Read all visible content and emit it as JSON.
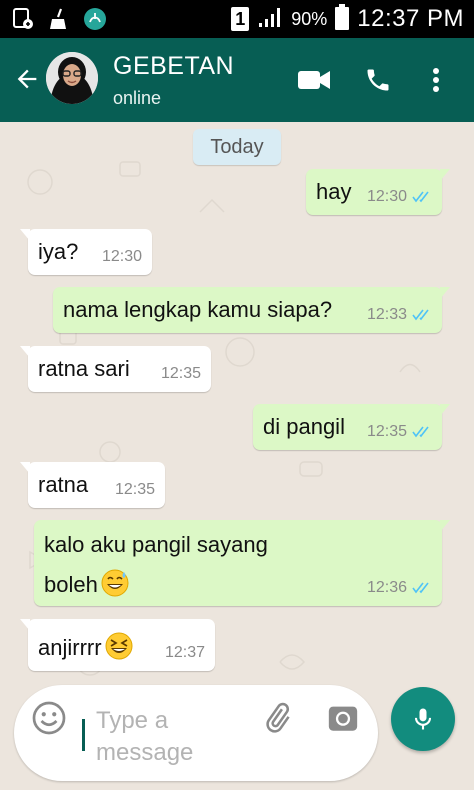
{
  "status_bar": {
    "sim_slot": "1",
    "battery_percent": "90%",
    "time": "12:37 PM",
    "icons": [
      "screenshot-icon",
      "cleaner-icon",
      "islamic-app-icon",
      "sim-icon",
      "signal-icon",
      "battery-icon"
    ]
  },
  "header": {
    "contact_name": "GEBETAN",
    "contact_status": "online",
    "icons": [
      "back-arrow-icon",
      "video-call-icon",
      "phone-call-icon",
      "more-vert-icon"
    ],
    "colors": {
      "bar": "#075e54"
    }
  },
  "chat": {
    "date_label": "Today",
    "messages": [
      {
        "direction": "out",
        "text": "hay",
        "time": "12:30",
        "read": true
      },
      {
        "direction": "in",
        "text": "iya?",
        "time": "12:30"
      },
      {
        "direction": "out",
        "text": "nama lengkap kamu siapa?",
        "time": "12:33",
        "read": true
      },
      {
        "direction": "in",
        "text": "ratna sari",
        "time": "12:35"
      },
      {
        "direction": "out",
        "text": "di pangil",
        "time": "12:35",
        "read": true
      },
      {
        "direction": "in",
        "text": "ratna",
        "time": "12:35"
      },
      {
        "direction": "out",
        "text_line1": "kalo aku pangil sayang",
        "text_line2": "boleh",
        "emoji": "sweat-smile-emoji",
        "time": "12:36",
        "read": true
      },
      {
        "direction": "in",
        "text": "anjirrrr",
        "emoji": "laughing-emoji",
        "time": "12:37"
      }
    ],
    "colors": {
      "background": "#ece5dd",
      "outgoing": "#dcf8c6",
      "incoming": "#ffffff",
      "read_ticks": "#4fc3f7"
    }
  },
  "composer": {
    "placeholder": "Type a message",
    "icons": [
      "emoji-icon",
      "attach-icon",
      "camera-icon",
      "mic-icon"
    ],
    "colors": {
      "send_button": "#128c7e"
    }
  }
}
